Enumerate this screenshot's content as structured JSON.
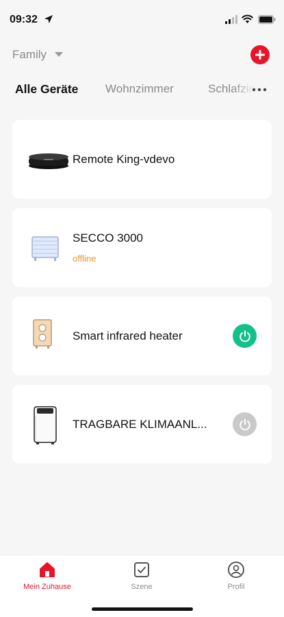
{
  "status_bar": {
    "time": "09:32"
  },
  "header": {
    "home_name": "Family"
  },
  "tabs": [
    {
      "label": "Alle Geräte",
      "active": true
    },
    {
      "label": "Wohnzimmer",
      "active": false
    },
    {
      "label": "Schlafzimmer",
      "active": false
    }
  ],
  "devices": [
    {
      "name": "Remote King-vdevo",
      "status": "",
      "power": "none"
    },
    {
      "name": "SECCO 3000",
      "status": "offline",
      "power": "none"
    },
    {
      "name": "Smart infrared heater",
      "status": "",
      "power": "on"
    },
    {
      "name": "TRAGBARE KLIMAANL...",
      "status": "",
      "power": "off"
    }
  ],
  "bottom_nav": [
    {
      "label": "Mein Zuhause",
      "icon": "home-icon",
      "active": true
    },
    {
      "label": "Szene",
      "icon": "scene-check-icon",
      "active": false
    },
    {
      "label": "Profil",
      "icon": "profile-icon",
      "active": false
    }
  ],
  "colors": {
    "accent_red": "#e8152a",
    "power_on": "#14c08a",
    "power_off": "#c9c9c9",
    "offline": "#f0951f",
    "background": "#f6f6f6"
  }
}
